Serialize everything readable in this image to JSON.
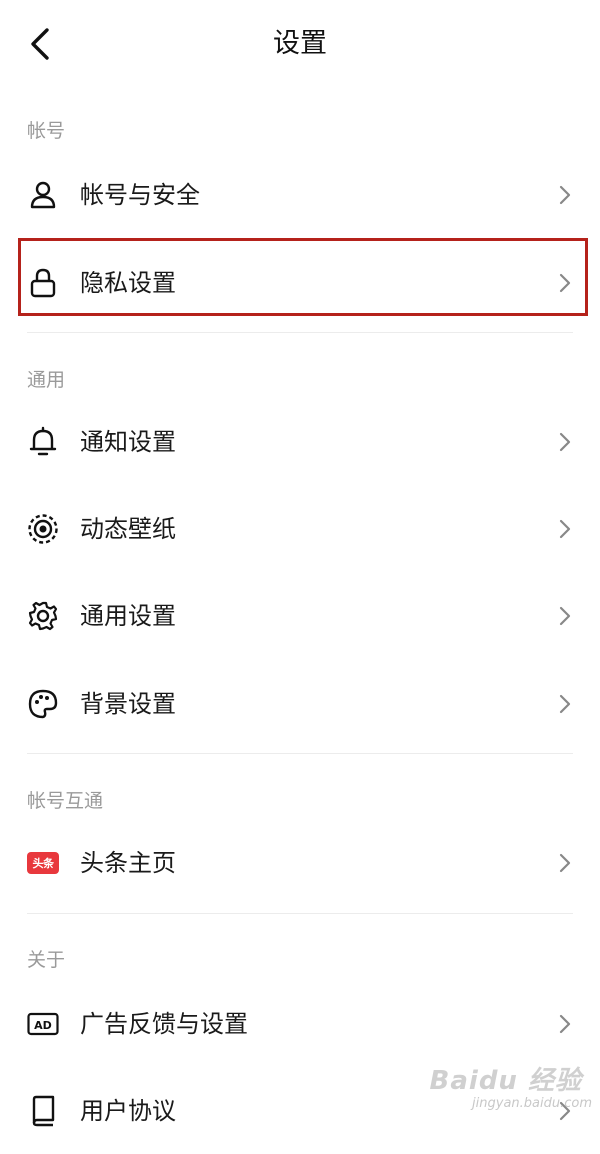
{
  "header": {
    "title": "设置"
  },
  "sections": [
    {
      "title": "帐号",
      "items": [
        {
          "label": "帐号与安全",
          "icon": "user-icon"
        },
        {
          "label": "隐私设置",
          "icon": "lock-icon"
        }
      ]
    },
    {
      "title": "通用",
      "items": [
        {
          "label": "通知设置",
          "icon": "bell-icon"
        },
        {
          "label": "动态壁纸",
          "icon": "live-wallpaper-icon"
        },
        {
          "label": "通用设置",
          "icon": "gear-icon"
        },
        {
          "label": "背景设置",
          "icon": "palette-icon"
        }
      ]
    },
    {
      "title": "帐号互通",
      "items": [
        {
          "label": "头条主页",
          "icon": "toutiao-icon",
          "badge_text": "头条"
        }
      ]
    },
    {
      "title": "关于",
      "items": [
        {
          "label": "广告反馈与设置",
          "icon": "ad-icon",
          "badge_text": "AD"
        },
        {
          "label": "用户协议",
          "icon": "book-icon"
        }
      ]
    }
  ],
  "highlight_color": "#b5221b",
  "watermark": {
    "logo": "Baidu 经验",
    "url": "jingyan.baidu.com"
  }
}
